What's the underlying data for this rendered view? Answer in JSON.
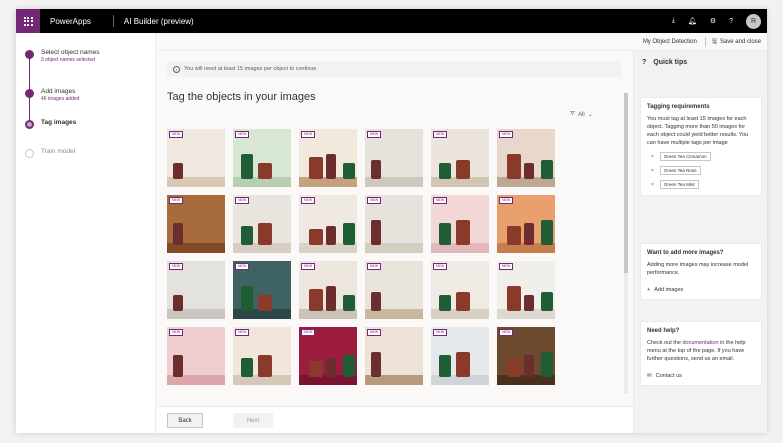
{
  "topbar": {
    "brand": "PowerApps",
    "app_title": "AI Builder (preview)",
    "icons": [
      "download-icon",
      "bell-icon",
      "gear-icon",
      "help-icon"
    ],
    "avatar_initial": "R"
  },
  "steps": [
    {
      "title": "Select object names",
      "subtitle": "3 object names selected",
      "state": "done"
    },
    {
      "title": "Add images",
      "subtitle": "46 images added",
      "state": "done"
    },
    {
      "title": "Tag images",
      "subtitle": "",
      "state": "current"
    },
    {
      "title": "Train model",
      "subtitle": "",
      "state": "todo"
    }
  ],
  "commandbar": {
    "model_name": "My Object Detection",
    "save_label": "Save and close"
  },
  "info_message": "You will need at least 15 images per object to continue",
  "heading": "Tag the objects in your images",
  "filter_label": "All",
  "badge_label": "NEW",
  "footer": {
    "back_label": "Back",
    "next_label": "Next"
  },
  "quick_tips": {
    "title": "Quick tips",
    "tagging": {
      "title": "Tagging requirements",
      "text": "You must tag at least 15 images for each object. Tagging more than 50 images for each object could yield better results. You can have multiple tags per image",
      "tags": [
        "Green Tea Cinnamon",
        "Green Tea Rose",
        "Green Tea Mint"
      ]
    },
    "more_images": {
      "title": "Want to add more images?",
      "text": "Adding more images may increase model performance.",
      "action": "Add images"
    },
    "help": {
      "title": "Need help?",
      "text_before": "Check out the",
      "link": "documentation",
      "text_after": "in the help menu at the top of the page. If you have further questions, send us an email.",
      "action": "Contact us"
    }
  },
  "colors": {
    "accent": "#742774",
    "topbar": "#000000"
  }
}
